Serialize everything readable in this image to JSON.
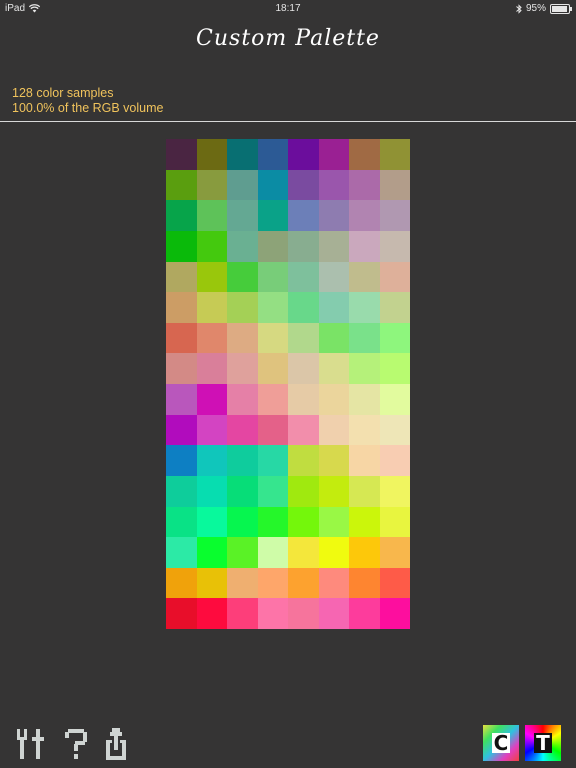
{
  "status": {
    "device": "iPad",
    "time": "18:17",
    "battery": "95%",
    "battery_level": 0.95
  },
  "title": "Custom Palette",
  "info": {
    "samples": "128 color samples",
    "volume": "100.0% of the RGB volume"
  },
  "palette": [
    [
      "#4a2542",
      "#6c6a13",
      "#086f72",
      "#2c5a95",
      "#6b0d9c",
      "#9a2093",
      "#a06a44",
      "#909234"
    ],
    [
      "#5a9e0f",
      "#889b3e",
      "#5f9d90",
      "#0b8ca4",
      "#7a4ba0",
      "#9a56ac",
      "#ab6aa9",
      "#b29d8a"
    ],
    [
      "#07a44a",
      "#5ec259",
      "#64a893",
      "#0aa288",
      "#6c7fb8",
      "#8e7cb0",
      "#b184b1",
      "#b098b1"
    ],
    [
      "#0aba0a",
      "#44c90e",
      "#6ab092",
      "#8da378",
      "#88ad90",
      "#a7b095",
      "#caa8bd",
      "#c6b9ae"
    ],
    [
      "#b0a860",
      "#99c70c",
      "#46cc3b",
      "#78cd79",
      "#7ec09c",
      "#abbfae",
      "#c0bc8d",
      "#deb09a"
    ],
    [
      "#cc9d65",
      "#c6cb55",
      "#a4d056",
      "#94df83",
      "#68d88a",
      "#84ccae",
      "#99dbac",
      "#c2d28f"
    ],
    [
      "#d76650",
      "#e0876b",
      "#ddab83",
      "#d6d981",
      "#b1d88c",
      "#7ae366",
      "#7ae18a",
      "#8ef67d"
    ],
    [
      "#d38a86",
      "#d97f9a",
      "#dfa19c",
      "#dfc37e",
      "#dbc6a8",
      "#d9dd8e",
      "#b5f17a",
      "#b8fb70"
    ],
    [
      "#b957bc",
      "#cf10b5",
      "#e580a7",
      "#ef9e98",
      "#e6cba6",
      "#ebd59c",
      "#e5e5a4",
      "#e2fb9e"
    ],
    [
      "#b10cbd",
      "#d344c2",
      "#e446a2",
      "#e46189",
      "#f28eab",
      "#f0d0ad",
      "#f3e0af",
      "#eee6b7"
    ],
    [
      "#0d7fc3",
      "#10c6bb",
      "#0fcc9d",
      "#27d8a5",
      "#c0dd40",
      "#d7d94d",
      "#f7d6a5",
      "#f8cdb2"
    ],
    [
      "#0ecd9b",
      "#07ddb0",
      "#07dd78",
      "#36e58e",
      "#a0e90f",
      "#c3ec0e",
      "#d6e853",
      "#f0f560"
    ],
    [
      "#09e286",
      "#08f99c",
      "#06f64f",
      "#25f72a",
      "#74f70b",
      "#99f845",
      "#cbf60b",
      "#e8f53f"
    ],
    [
      "#2ceaa6",
      "#09fe2e",
      "#5af226",
      "#cffca8",
      "#f4e73b",
      "#f0fb0f",
      "#fdc80a",
      "#f8b74c"
    ],
    [
      "#f0a20b",
      "#e8c107",
      "#efaf70",
      "#fea66a",
      "#fda22f",
      "#fe8a7d",
      "#fe8530",
      "#fe5b48"
    ],
    [
      "#e80e2a",
      "#fe0b3e",
      "#fd3e7a",
      "#fd74a8",
      "#f6749c",
      "#f666b2",
      "#fd3c9c",
      "#fd0e9e"
    ]
  ],
  "toolbar": {
    "tools_icon": "tools-icon",
    "help_icon": "question-mark-icon",
    "share_icon": "share-icon",
    "palette_c_label": "C",
    "palette_t_label": "T"
  },
  "colors": {
    "background": "#353434",
    "accent": "#f0c35c",
    "icon": "#cfd4d2"
  }
}
